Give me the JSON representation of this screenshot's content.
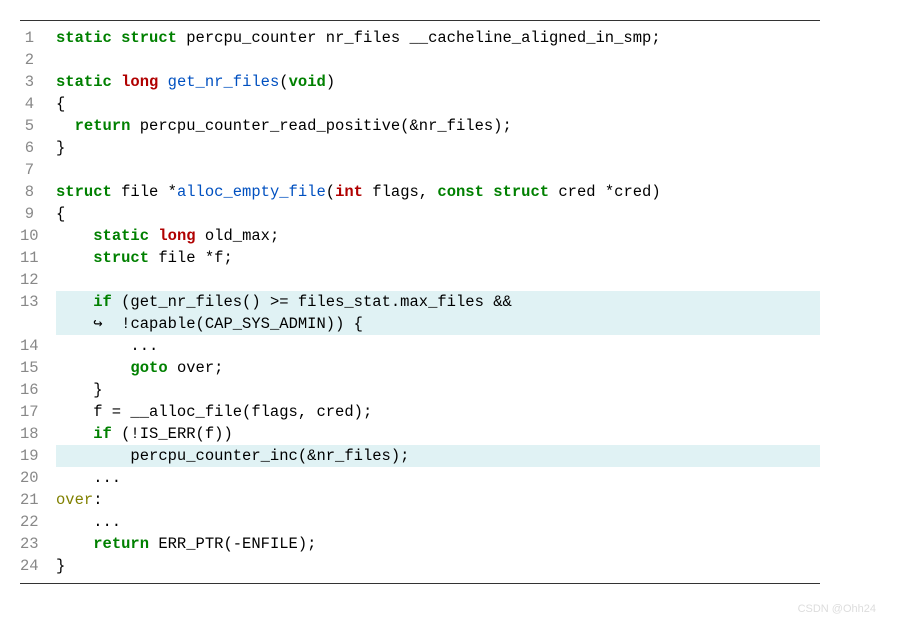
{
  "code": {
    "lines": [
      {
        "num": "1",
        "hl": false,
        "tokens": [
          {
            "cls": "kw-green",
            "t": "static"
          },
          {
            "cls": "",
            "t": " "
          },
          {
            "cls": "kw-green",
            "t": "struct"
          },
          {
            "cls": "",
            "t": " percpu_counter nr_files __cacheline_aligned_in_smp;"
          }
        ]
      },
      {
        "num": "2",
        "hl": false,
        "tokens": []
      },
      {
        "num": "3",
        "hl": false,
        "tokens": [
          {
            "cls": "kw-green",
            "t": "static"
          },
          {
            "cls": "",
            "t": " "
          },
          {
            "cls": "kw-red",
            "t": "long"
          },
          {
            "cls": "",
            "t": " "
          },
          {
            "cls": "fn-blue",
            "t": "get_nr_files"
          },
          {
            "cls": "",
            "t": "("
          },
          {
            "cls": "kw-green",
            "t": "void"
          },
          {
            "cls": "",
            "t": ")"
          }
        ]
      },
      {
        "num": "4",
        "hl": false,
        "tokens": [
          {
            "cls": "",
            "t": "{"
          }
        ]
      },
      {
        "num": "5",
        "hl": false,
        "tokens": [
          {
            "cls": "",
            "t": "  "
          },
          {
            "cls": "kw-green",
            "t": "return"
          },
          {
            "cls": "",
            "t": " percpu_counter_read_positive(&nr_files);"
          }
        ]
      },
      {
        "num": "6",
        "hl": false,
        "tokens": [
          {
            "cls": "",
            "t": "}"
          }
        ]
      },
      {
        "num": "7",
        "hl": false,
        "tokens": []
      },
      {
        "num": "8",
        "hl": false,
        "tokens": [
          {
            "cls": "kw-green",
            "t": "struct"
          },
          {
            "cls": "",
            "t": " file *"
          },
          {
            "cls": "fn-blue",
            "t": "alloc_empty_file"
          },
          {
            "cls": "",
            "t": "("
          },
          {
            "cls": "kw-red",
            "t": "int"
          },
          {
            "cls": "",
            "t": " flags, "
          },
          {
            "cls": "kw-green",
            "t": "const"
          },
          {
            "cls": "",
            "t": " "
          },
          {
            "cls": "kw-green",
            "t": "struct"
          },
          {
            "cls": "",
            "t": " cred *cred)"
          }
        ]
      },
      {
        "num": "9",
        "hl": false,
        "tokens": [
          {
            "cls": "",
            "t": "{"
          }
        ]
      },
      {
        "num": "10",
        "hl": false,
        "tokens": [
          {
            "cls": "",
            "t": "    "
          },
          {
            "cls": "kw-green",
            "t": "static"
          },
          {
            "cls": "",
            "t": " "
          },
          {
            "cls": "kw-red",
            "t": "long"
          },
          {
            "cls": "",
            "t": " old_max;"
          }
        ]
      },
      {
        "num": "11",
        "hl": false,
        "tokens": [
          {
            "cls": "",
            "t": "    "
          },
          {
            "cls": "kw-green",
            "t": "struct"
          },
          {
            "cls": "",
            "t": " file *f;"
          }
        ]
      },
      {
        "num": "12",
        "hl": false,
        "tokens": []
      },
      {
        "num": "13",
        "hl": true,
        "tokens": [
          {
            "cls": "",
            "t": "    "
          },
          {
            "cls": "kw-green",
            "t": "if"
          },
          {
            "cls": "",
            "t": " (get_nr_files() >= files_stat.max_files &&"
          }
        ]
      },
      {
        "num": "",
        "hl": true,
        "tokens": [
          {
            "cls": "",
            "t": "    ↪  !capable(CAP_SYS_ADMIN)) {"
          }
        ]
      },
      {
        "num": "14",
        "hl": false,
        "tokens": [
          {
            "cls": "",
            "t": "        ..."
          }
        ]
      },
      {
        "num": "15",
        "hl": false,
        "tokens": [
          {
            "cls": "",
            "t": "        "
          },
          {
            "cls": "kw-green",
            "t": "goto"
          },
          {
            "cls": "",
            "t": " over;"
          }
        ]
      },
      {
        "num": "16",
        "hl": false,
        "tokens": [
          {
            "cls": "",
            "t": "    }"
          }
        ]
      },
      {
        "num": "17",
        "hl": false,
        "tokens": [
          {
            "cls": "",
            "t": "    f = __alloc_file(flags, cred);"
          }
        ]
      },
      {
        "num": "18",
        "hl": false,
        "tokens": [
          {
            "cls": "",
            "t": "    "
          },
          {
            "cls": "kw-green",
            "t": "if"
          },
          {
            "cls": "",
            "t": " (!IS_ERR(f))"
          }
        ]
      },
      {
        "num": "19",
        "hl": true,
        "tokens": [
          {
            "cls": "",
            "t": "        percpu_counter_inc(&nr_files);"
          }
        ]
      },
      {
        "num": "20",
        "hl": false,
        "tokens": [
          {
            "cls": "",
            "t": "    ..."
          }
        ]
      },
      {
        "num": "21",
        "hl": false,
        "tokens": [
          {
            "cls": "label",
            "t": "over"
          },
          {
            "cls": "",
            "t": ":"
          }
        ]
      },
      {
        "num": "22",
        "hl": false,
        "tokens": [
          {
            "cls": "",
            "t": "    ..."
          }
        ]
      },
      {
        "num": "23",
        "hl": false,
        "tokens": [
          {
            "cls": "",
            "t": "    "
          },
          {
            "cls": "kw-green",
            "t": "return"
          },
          {
            "cls": "",
            "t": " ERR_PTR(-ENFILE);"
          }
        ]
      },
      {
        "num": "24",
        "hl": false,
        "tokens": [
          {
            "cls": "",
            "t": "}"
          }
        ]
      }
    ]
  },
  "watermark": "CSDN @Ohh24"
}
